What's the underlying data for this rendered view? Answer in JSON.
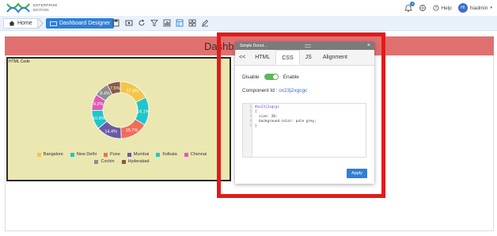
{
  "header": {
    "logo_line1": "ENTERPRISE",
    "logo_line2": "EDITION",
    "notification_count": "4",
    "help_label": "Help",
    "user_initials": "HI",
    "username": "hiadmin"
  },
  "breadcrumb": {
    "home_label": "Home",
    "dashboard_designer_label": "Dashboard Designer"
  },
  "toolbar_icons": [
    "save-icon",
    "preview-icon",
    "refresh-icon",
    "filter-icon",
    "chart-icon",
    "layout-icon",
    "grid-icon",
    "edit-icon"
  ],
  "dashboard": {
    "title": "Dashb"
  },
  "widget": {
    "label": "HTML Code",
    "background": "#ebe7b1"
  },
  "chart_data": {
    "type": "pie",
    "donut": true,
    "title": "",
    "categories": [
      "Bangalore",
      "New Delhi",
      "Pune",
      "Mumbai",
      "Kolkata",
      "Chennai",
      "Cochin",
      "Hyderabad"
    ],
    "values": [
      17.6,
      16.1,
      15.7,
      14.4,
      10.9,
      9.2,
      8.4,
      7.5
    ],
    "labels": [
      "17.6%",
      "16.1%",
      "15.7%",
      "14.4%",
      "10.9%",
      "9.2%",
      "8.4%",
      "7.5%"
    ],
    "colors": [
      "#f2c64a",
      "#21c5c9",
      "#f26d57",
      "#6b5aa6",
      "#21c5c9",
      "#e05ab7",
      "#8e8e8e",
      "#8a5a44"
    ],
    "legend_placement": "bottom"
  },
  "legend": [
    {
      "label": "Bangalore",
      "color": "#f2c64a"
    },
    {
      "label": "New Delhi",
      "color": "#21c5c9"
    },
    {
      "label": "Pune",
      "color": "#f26d57"
    },
    {
      "label": "Mumbai",
      "color": "#6b5aa6"
    },
    {
      "label": "Kolkata",
      "color": "#21c5c9"
    },
    {
      "label": "Chennai",
      "color": "#e05ab7"
    },
    {
      "label": "Cochin",
      "color": "#8e8e8e"
    },
    {
      "label": "Hyderabad",
      "color": "#8a5a44"
    }
  ],
  "modal": {
    "title": "Simple Donut...",
    "close": "×",
    "tabs": [
      "<<",
      "HTML",
      "CSS",
      "JS",
      "Alignment"
    ],
    "active_tab": "CSS",
    "toggle_off_label": "Disable",
    "toggle_on_label": "Enable",
    "component_id_label": "Component Id :",
    "component_id_value": "ox23j2xgcgc",
    "code_lines": [
      {
        "num": "1",
        "text": "#ox23j2xgcgc"
      },
      {
        "num": "2",
        "text": "{"
      },
      {
        "num": "3",
        "text": "  size: 20;"
      },
      {
        "num": "4",
        "text": "  background-color: pale grey;"
      },
      {
        "num": "5",
        "text": "}"
      }
    ],
    "apply_label": "Apply"
  },
  "colors": {
    "accent": "#2f7fd6",
    "title_bar": "#e07070",
    "highlight": "#e11b1b",
    "toggle_on": "#5cb85c"
  }
}
